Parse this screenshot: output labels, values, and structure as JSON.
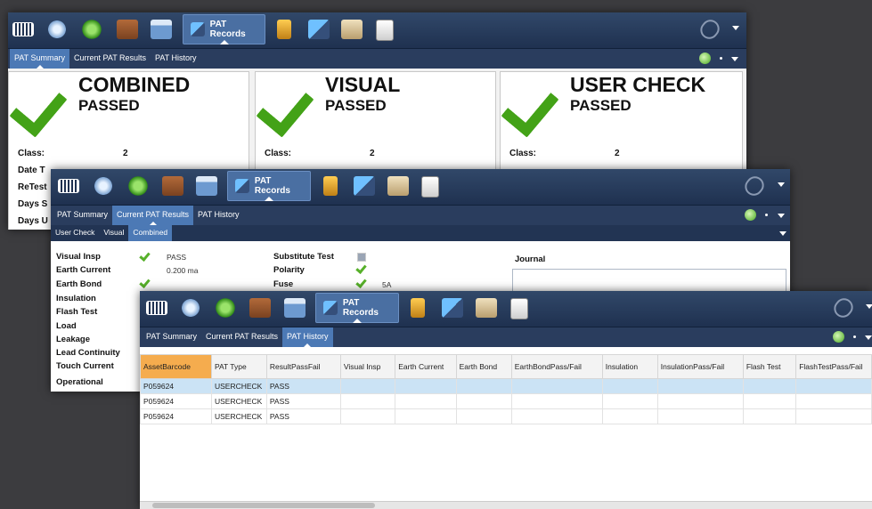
{
  "colors": {
    "toolbar": "#2a3d5e",
    "active_tab": "#4c79b5",
    "pass_green": "#43a217",
    "selected_header": "#f5ac4e",
    "highlight_row": "#cbe3f5"
  },
  "icons": [
    "barcode-icon",
    "network-icon",
    "green-orb-icon",
    "toolbox-icon",
    "calendar-icon",
    "pat-records-icon",
    "battery-icon",
    "computer-icon",
    "building-icon",
    "clipboard-icon",
    "paperclip-icon",
    "green-globe-icon"
  ],
  "window1": {
    "toolbar": {
      "pat_records_label": "PAT Records"
    },
    "tabs": [
      {
        "label": "PAT Summary"
      },
      {
        "label": "Current PAT Results"
      },
      {
        "label": "PAT History"
      }
    ],
    "cards": [
      {
        "title": "COMBINED",
        "status": "PASSED"
      },
      {
        "title": "VISUAL",
        "status": "PASSED"
      },
      {
        "title": "USER CHECK",
        "status": "PASSED"
      }
    ],
    "card_fields": {
      "class_label": "Class:",
      "class_value": "2"
    },
    "side_labels": [
      "Date T",
      "ReTest",
      "Days S",
      "Days U"
    ]
  },
  "window2": {
    "toolbar": {
      "pat_records_label": "PAT Records"
    },
    "tabs": [
      {
        "label": "PAT Summary"
      },
      {
        "label": "Current PAT Results"
      },
      {
        "label": "PAT History"
      }
    ],
    "subtabs": [
      {
        "label": "User Check"
      },
      {
        "label": "Visual"
      },
      {
        "label": "Combined"
      }
    ],
    "left_labels": [
      "Visual Insp",
      "Earth Current",
      "Earth Bond",
      "Insulation",
      "Flash Test",
      "Load",
      "Leakage",
      "Lead Continuity",
      "Touch Current",
      "Operational"
    ],
    "visual_insp_value": "PASS",
    "earth_current_value": "0.200 ma",
    "right_labels": [
      "Substitute Test",
      "Polarity",
      "Fuse"
    ],
    "fuse_value": "5A",
    "journal_label": "Journal"
  },
  "window3": {
    "toolbar": {
      "pat_records_label": "PAT Records"
    },
    "tabs": [
      {
        "label": "PAT Summary"
      },
      {
        "label": "Current PAT Results"
      },
      {
        "label": "PAT History"
      }
    ],
    "columns": [
      "AssetBarcode",
      "PAT Type",
      "ResultPassFail",
      "Visual Insp",
      "Earth Current",
      "Earth Bond",
      "EarthBondPass/Fail",
      "Insulation",
      "InsulationPass/Fail",
      "Flash Test",
      "FlashTestPass/Fail"
    ],
    "rows": [
      [
        "P059624",
        "USERCHECK",
        "PASS",
        "",
        "",
        "",
        "",
        "",
        "",
        "",
        ""
      ],
      [
        "P059624",
        "USERCHECK",
        "PASS",
        "",
        "",
        "",
        "",
        "",
        "",
        "",
        ""
      ],
      [
        "P059624",
        "USERCHECK",
        "PASS",
        "",
        "",
        "",
        "",
        "",
        "",
        "",
        ""
      ]
    ]
  }
}
